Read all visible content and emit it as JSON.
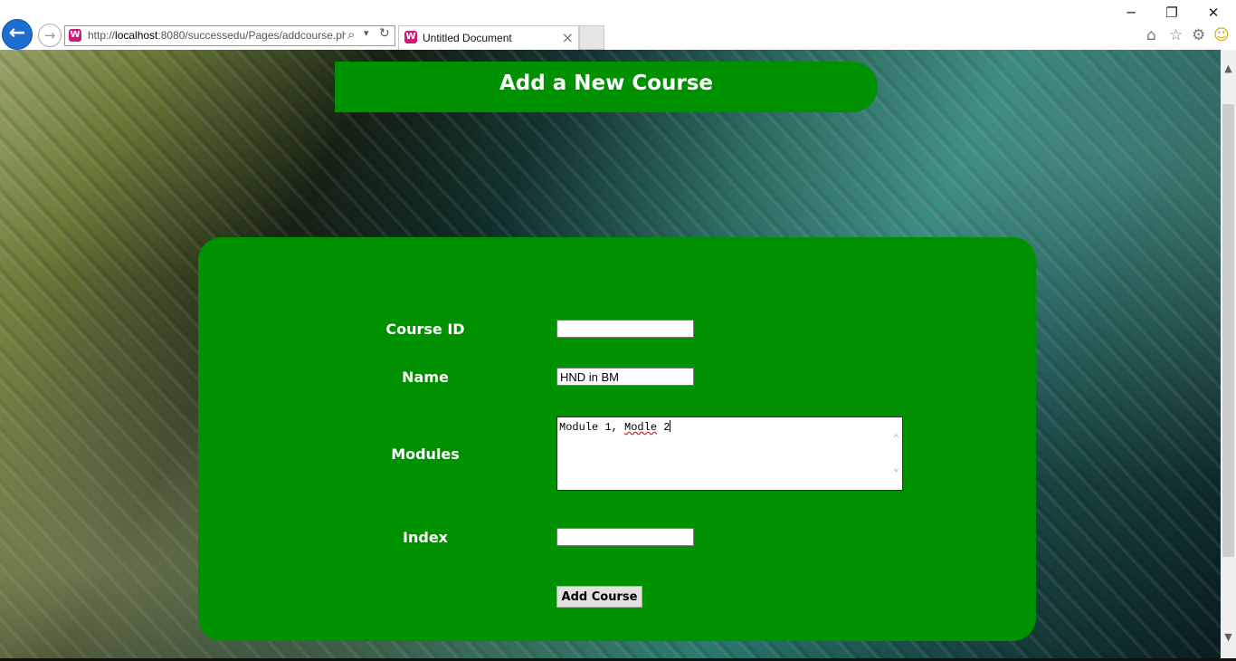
{
  "browser": {
    "url_prefix": "http://",
    "url_host": "localhost",
    "url_rest": ":8080/successedu/Pages/addcourse.ph",
    "tab_title": "Untitled Document",
    "tab_close": "×",
    "minimize": "─",
    "restore": "❐",
    "close": "✕",
    "back_icon": "←",
    "forward_icon": "→",
    "search_icon": "⌕",
    "dropdown_icon": "▾",
    "refresh_icon": "↻",
    "home_icon": "⌂",
    "favorites_icon": "☆",
    "settings_icon": "⚙",
    "feedback_icon": "☺",
    "favicon_letter": "W"
  },
  "page": {
    "header_title": "Add a New Course",
    "form": {
      "course_id_label": "Course ID",
      "course_id_value": "",
      "name_label": "Name",
      "name_value": "HND in BM",
      "modules_label": "Modules",
      "modules_value_part1": "Module 1, ",
      "modules_value_misspelled": "Modle",
      "modules_value_part2": " 2",
      "index_label": "Index",
      "index_value": "",
      "submit_label": "Add Course"
    }
  },
  "scrollbar": {
    "up": "▲",
    "down": "▼"
  },
  "colors": {
    "panel_green": "#009100",
    "browser_blue": "#1c6fd1",
    "favicon_pink": "#d6167d"
  }
}
